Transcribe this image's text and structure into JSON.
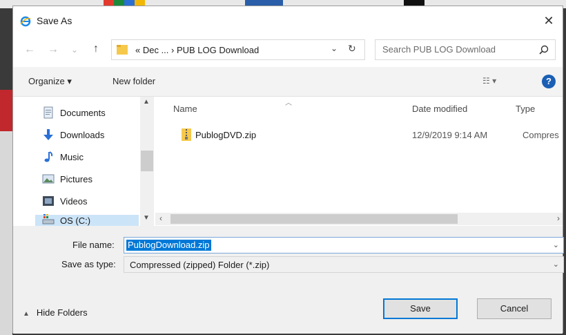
{
  "dialog": {
    "title": "Save As",
    "close_label": "✕"
  },
  "nav": {
    "back_label": "←",
    "forward_label": "→",
    "recent_label": "⌄",
    "up_label": "↑",
    "address_path": "« Dec ... › PUB LOG Download",
    "search_placeholder": "Search PUB LOG Download"
  },
  "toolbar": {
    "organize_label": "Organize ▾",
    "new_folder_label": "New folder",
    "view_label": "☷ ▾",
    "help_label": "?"
  },
  "sidebar": {
    "items": [
      {
        "label": "Documents"
      },
      {
        "label": "Downloads"
      },
      {
        "label": "Music"
      },
      {
        "label": "Pictures"
      },
      {
        "label": "Videos"
      },
      {
        "label": "OS (C:)"
      }
    ]
  },
  "file_list": {
    "columns": [
      "Name",
      "Date modified",
      "Type"
    ],
    "rows": [
      {
        "name": "PublogDVD.zip",
        "date": "12/9/2019 9:14 AM",
        "type": "Compres"
      }
    ]
  },
  "form": {
    "file_name_label": "File name:",
    "file_name_value": "PublogDownload.zip",
    "save_type_label": "Save as type:",
    "save_type_value": "Compressed (zipped) Folder (*.zip)"
  },
  "footer": {
    "hide_folders_label": "Hide Folders",
    "save_label": "Save",
    "cancel_label": "Cancel"
  },
  "colors": {
    "accent": "#0078d7",
    "selection": "#cce4f7"
  }
}
